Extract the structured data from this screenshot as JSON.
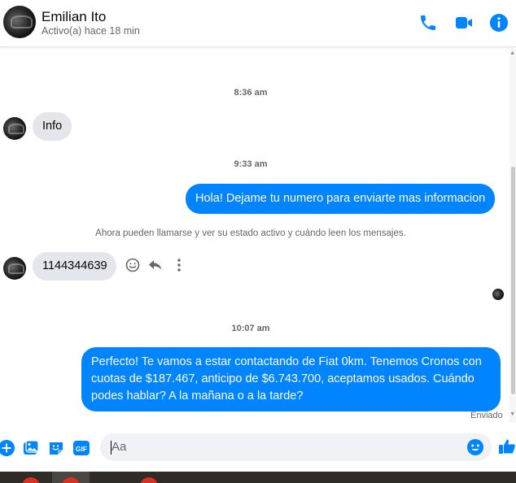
{
  "contact": {
    "name": "Emilian Ito",
    "status": "Activo(a) hace 18 min"
  },
  "header_icons": [
    "phone-icon",
    "video-camera-icon",
    "info-icon"
  ],
  "colors": {
    "accent": "#0084ff",
    "incoming_bubble": "#e4e6eb",
    "meta_text": "#65676b"
  },
  "thread": {
    "ts1": "8:36 am",
    "msg1": "Info",
    "ts2": "9:33 am",
    "msg2": "Hola! Dejame tu numero para enviarte mas informacion",
    "notice": "Ahora pueden llamarse y ver su estado activo y cuándo leen los mensajes.",
    "msg3": "1144344639",
    "ts3": "10:07 am",
    "msg4": "Perfecto! Te vamos a estar contactando de Fiat 0km. Tenemos Cronos con cuotas de $187.467, anticipo de $6.743.700, aceptamos usados. Cuándo podes hablar? A la mañana o a la tarde?",
    "delivery": "Enviado"
  },
  "composer": {
    "placeholder": "Aa",
    "gif_label": "GIF"
  }
}
